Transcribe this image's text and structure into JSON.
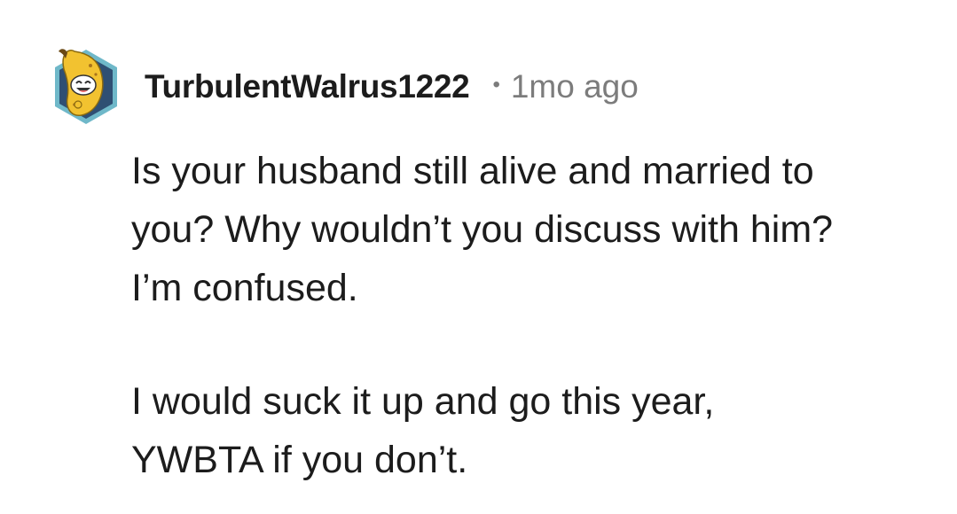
{
  "comment": {
    "username": "TurbulentWalrus1222",
    "separator": "•",
    "timestamp": "1mo ago",
    "avatar_icon": "banana-snoo-avatar-icon",
    "paragraphs": [
      {
        "lines": [
          "Is your husband still alive and married to",
          "you? Why wouldn’t you discuss with him?",
          "I’m confused."
        ]
      },
      {
        "lines": [
          "I would suck it up and go this year,",
          "YWBTA if you don’t."
        ]
      }
    ]
  },
  "colors": {
    "text": "#1c1c1c",
    "meta": "#7c7c7c",
    "avatar_border": "#6fb8c9",
    "avatar_bg": "#2f4f73",
    "banana": "#f2c230"
  }
}
